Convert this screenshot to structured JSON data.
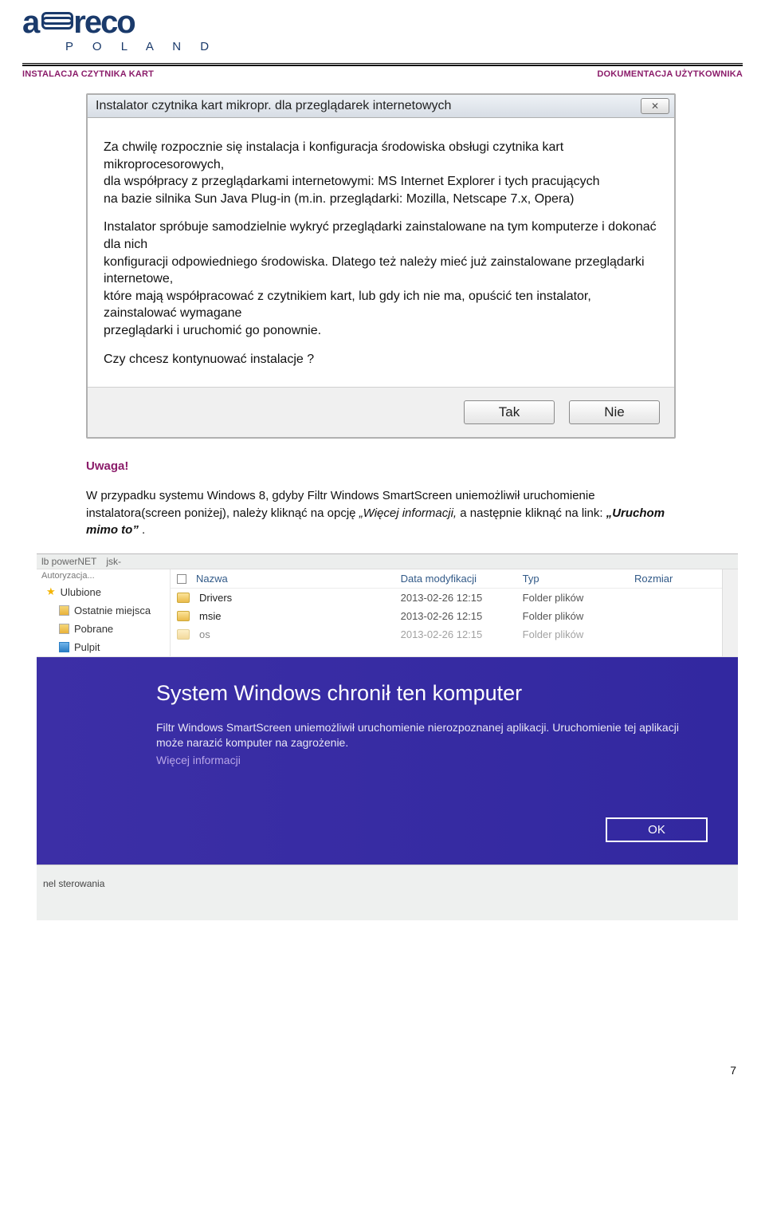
{
  "logo": {
    "letters_a": "a",
    "letters_b": "reco",
    "sub": "P O L A N D"
  },
  "hdr": {
    "left": "INSTALACJA CZYTNIKA KART",
    "right": "DOKUMENTACJA UŻYTKOWNIKA"
  },
  "dlg": {
    "title": "Instalator czytnika kart mikropr. dla przeglądarek internetowych",
    "close_glyph": "✕",
    "para1": "Za chwilę rozpocznie się instalacja i konfiguracja środowiska obsługi czytnika kart mikroprocesorowych,\ndla współpracy z przeglądarkami internetowymi: MS Internet Explorer i tych pracujących\nna bazie silnika Sun Java Plug-in (m.in. przeglądarki: Mozilla, Netscape 7.x, Opera)",
    "para2": "Instalator spróbuje samodzielnie wykryć przeglądarki zainstalowane na tym komputerze i dokonać dla nich\nkonfiguracji odpowiedniego środowiska. Dlatego też należy mieć już zainstalowane przeglądarki internetowe,\nktóre mają współpracować z czytnikiem kart, lub gdy ich nie ma, opuścić ten instalator, zainstalować wymagane\nprzeglądarki i uruchomić go ponownie.",
    "para3": "Czy chcesz kontynuować instalacje ?",
    "yes": "Tak",
    "no": "Nie"
  },
  "text": {
    "attention": "Uwaga!",
    "body_a": "W przypadku systemu Windows 8, gdyby Filtr Windows SmartScreen uniemożliwił uruchomienie instalatora(screen poniżej), należy kliknąć na opcję ",
    "body_link1": "„Więcej informacji,",
    "body_mid": "  a następnie kliknąć na link: ",
    "body_link2": "„Uruchom mimo to”",
    "body_end": "."
  },
  "explorer": {
    "topfrag1": "jsk-",
    "topfrag2": "-",
    "sidebar": {
      "root": "Ulubione",
      "items": [
        "Ostatnie miejsca",
        "Pobrane",
        "Pulpit"
      ]
    },
    "cols": {
      "name": "Nazwa",
      "date": "Data modyfikacji",
      "type": "Typ",
      "size": "Rozmiar"
    },
    "rows": [
      {
        "name": "Drivers",
        "date": "2013-02-26 12:15",
        "type": "Folder plików",
        "size": ""
      },
      {
        "name": "msie",
        "date": "2013-02-26 12:15",
        "type": "Folder plików",
        "size": ""
      },
      {
        "name": "os",
        "date": "2013-02-26 12:15",
        "type": "Folder plików",
        "size": ""
      }
    ]
  },
  "ss": {
    "title": "System Windows chronił ten komputer",
    "body": "Filtr Windows SmartScreen uniemożliwił uruchomienie nierozpoznanej aplikacji. Uruchomienie tej aplikacji może narazić komputer na zagrożenie.",
    "more": "Więcej informacji",
    "ok": "OK"
  },
  "post": "nel sterowania",
  "pagenum": "7"
}
